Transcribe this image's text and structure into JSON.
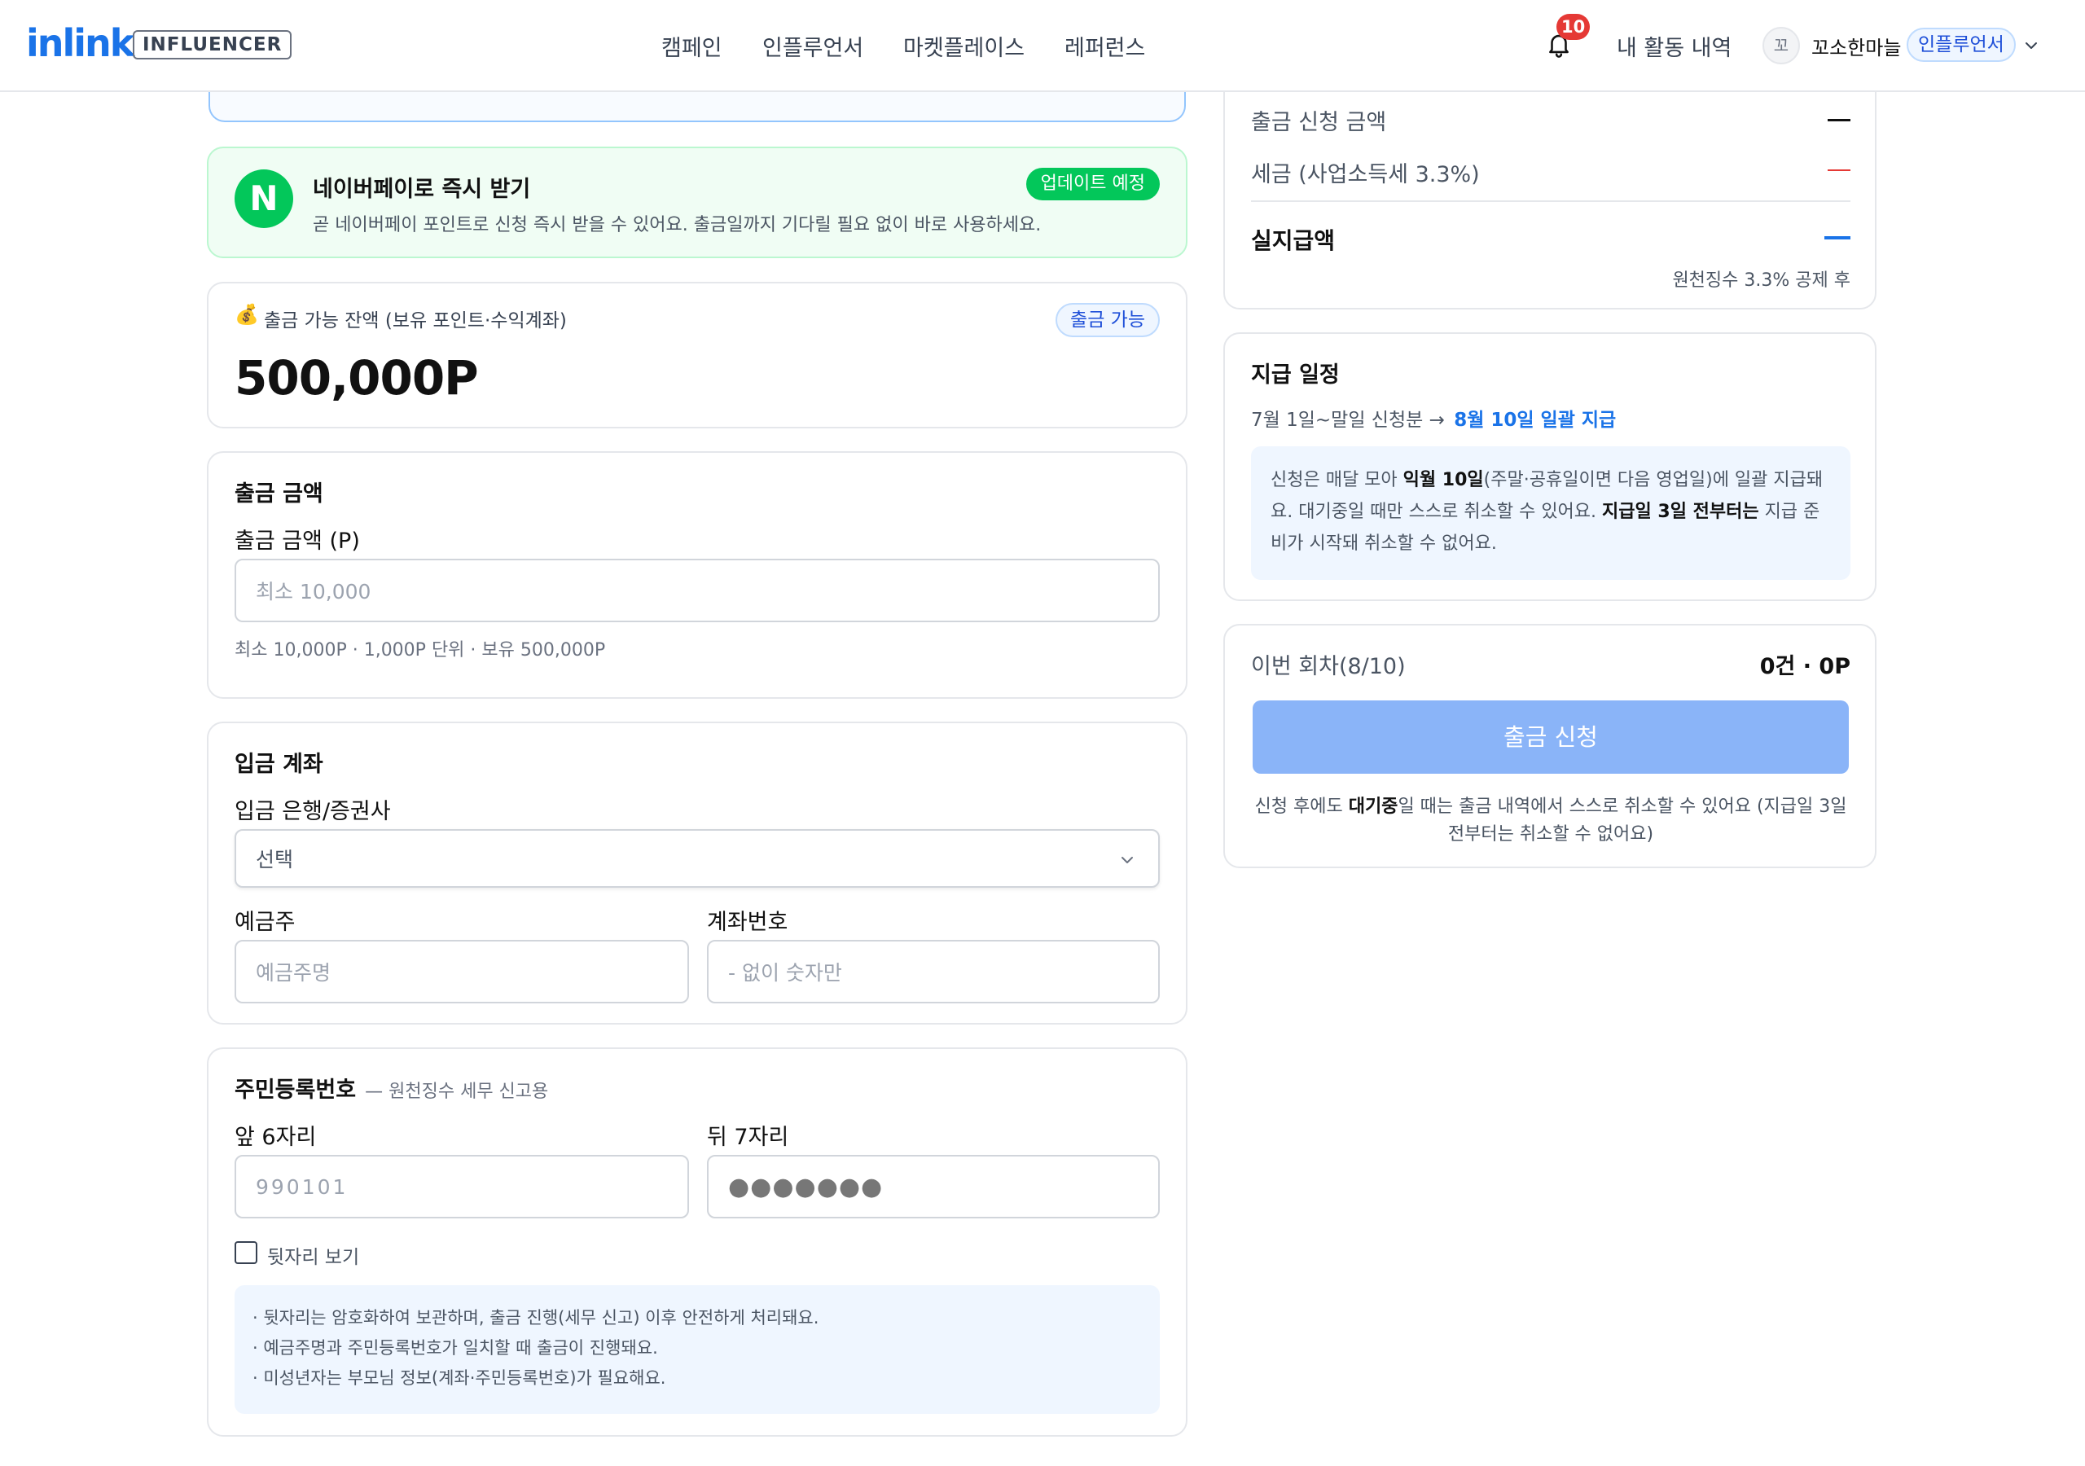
{
  "header": {
    "logo": "inlink",
    "logo_badge": "INFLUENCER",
    "nav": [
      "캠페인",
      "인플루언서",
      "마켓플레이스",
      "레퍼런스"
    ],
    "notification_count": "10",
    "activity_label": "내 활동 내역",
    "avatar_initial": "꼬",
    "username": "꼬소한마늘",
    "role": "인플루언서"
  },
  "naverpay": {
    "logo_letter": "N",
    "title": "네이버페이로 즉시 받기",
    "description": "곧 네이버페이 포인트로 신청 즉시 받을 수 있어요. 출금일까지 기다릴 필요 없이 바로 사용하세요.",
    "badge": "업데이트 예정"
  },
  "balance": {
    "icon_glyph": "💰",
    "label": "출금 가능 잔액 (보유 포인트·수익계좌)",
    "badge": "출금 가능",
    "amount": "500,000P"
  },
  "amount_section": {
    "title": "출금 금액",
    "field_label": "출금 금액 (P)",
    "placeholder": "최소 10,000",
    "hint": "최소 10,000P · 1,000P 단위 · 보유 500,000P"
  },
  "account_section": {
    "title": "입금 계좌",
    "bank_label": "입금 은행/증권사",
    "bank_selected": "선택",
    "holder_label": "예금주",
    "holder_placeholder": "예금주명",
    "number_label": "계좌번호",
    "number_placeholder": "- 없이 숫자만"
  },
  "rrn_section": {
    "title": "주민등록번호",
    "subtitle": "— 원천징수 세무 신고용",
    "front_label": "앞 6자리",
    "front_placeholder": "990101",
    "back_label": "뒤 7자리",
    "back_value": "●●●●●●●",
    "show_label": "뒷자리 보기",
    "notes": [
      "· 뒷자리는 암호화하여 보관하며, 출금 진행(세무 신고) 이후 안전하게 처리돼요.",
      "· 예금주명과 주민등록번호가 일치할 때 출금이 진행돼요.",
      "· 미성년자는 부모님 정보(계좌·주민등록번호)가 필요해요."
    ]
  },
  "summary": {
    "request_label": "출금 신청 금액",
    "tax_label": "세금 (사업소득세 3.3%)",
    "net_label": "실지급액",
    "net_note": "원천징수 3.3% 공제 후",
    "request_color": "#111111",
    "tax_color": "#e53935",
    "net_color": "#1a73e8"
  },
  "schedule": {
    "title": "지급 일정",
    "period": "7월 1일~말일 신청분 →",
    "payout": "8월 10일 일괄 지급",
    "info_1": "신청은 매달 모아 ",
    "info_1_bold": "익월 10일",
    "info_2": "(주말·공휴일이면 다음 영업일)에 일괄 지급돼요. 대기중일 때만 스스로 취소할 수 있어요. ",
    "info_2_bold": "지급일 3일 전부터는",
    "info_3": " 지급 준비가 시작돼 취소할 수 없어요."
  },
  "submit": {
    "round_label": "이번 회차(8/10)",
    "round_value": "0건 · 0P",
    "button_label": "출금 신청",
    "note_1": "신청 후에도 ",
    "note_bold": "대기중",
    "note_2": "일 때는 출금 내역에서 스스로 취소할 수 있어요 (지급일 3일 전부터는 취소할 수 없어요)"
  },
  "colors": {
    "brand": "#1a73e8",
    "naver_green": "#03c75a",
    "naver_bg": "#f0fdf4",
    "button_disabled": "#8ab4f8",
    "info_bg": "#eff6ff"
  }
}
